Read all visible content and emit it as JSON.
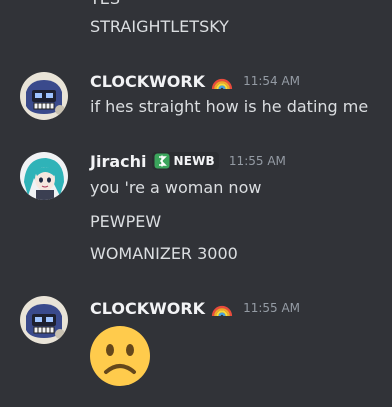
{
  "messages": {
    "partial_line": "YES",
    "cont_1": "STRAIGHTLETSKY",
    "m1": {
      "username": "CLOCKWORK",
      "time": "11:54 AM",
      "text": "if hes straight how is he dating me"
    },
    "m2": {
      "username": "Jirachi",
      "badge": "NEWB",
      "time": "11:55 AM",
      "lines": [
        "you 're a woman now",
        "PEWPEW",
        "WOMANIZER 3000"
      ]
    },
    "m3": {
      "username": "CLOCKWORK",
      "time": "11:55 AM",
      "emoji": "frowning-face-emoji"
    }
  },
  "colors": {
    "background": "#313338",
    "text": "#dbdee1",
    "username": "#f2f3f5",
    "timestamp": "#949ba4",
    "newb_green": "#3ba55c"
  },
  "icons": {
    "pride_flag": "rainbow-emoji",
    "newb_badge": "green-dollar-badge-icon"
  }
}
